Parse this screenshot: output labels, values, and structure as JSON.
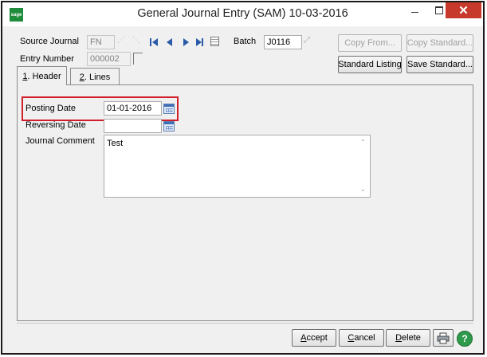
{
  "window": {
    "title": "General Journal Entry (SAM) 10-03-2016",
    "app_icon_text": "sage",
    "close_glyph": "✕"
  },
  "header": {
    "source_journal_label": "Source Journal",
    "source_journal_value": "FN",
    "entry_number_label": "Entry Number",
    "entry_number_value": "000002",
    "batch_label": "Batch",
    "batch_value": "J0116"
  },
  "toolbar": {
    "copy_from_label": "Copy From...",
    "copy_standard_label": "Copy Standard...",
    "standard_listing_label": "Standard Listing",
    "save_standard_label": "Save Standard..."
  },
  "tabs": [
    {
      "number": "1",
      "label": ". Header"
    },
    {
      "number": "2",
      "label": ". Lines"
    }
  ],
  "form": {
    "posting_date_label": "Posting Date",
    "posting_date_value": "01-01-2016",
    "reversing_date_label": "Reversing Date",
    "reversing_date_value": "",
    "journal_comment_label": "Journal Comment",
    "journal_comment_value": "Test"
  },
  "footer": {
    "accept_label": "ccept",
    "accept_mnemonic": "A",
    "cancel_label": "ancel",
    "cancel_mnemonic": "C",
    "delete_label": "elete",
    "delete_mnemonic": "D",
    "help_glyph": "?"
  },
  "colors": {
    "highlight": "#d11e2b",
    "close_button": "#c7392b",
    "sage_green": "#1e8c3a",
    "nav_blue": "#2a5aa8"
  },
  "icons": [
    "sage-logo-icon",
    "lookup-icon",
    "first-record-icon",
    "previous-record-icon",
    "next-record-icon",
    "last-record-icon",
    "list-icon",
    "calendar-icon",
    "printer-icon",
    "help-icon"
  ]
}
